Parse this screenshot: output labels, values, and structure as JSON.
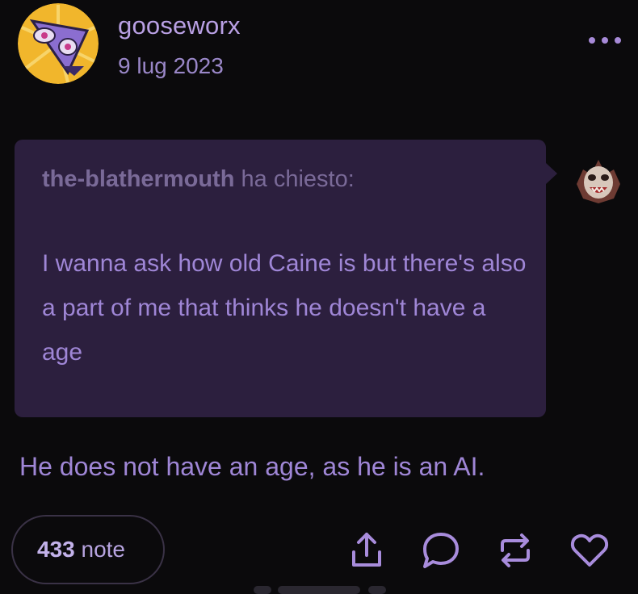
{
  "post": {
    "author": "gooseworx",
    "date": "9 lug 2023",
    "ask": {
      "asker": "the-blathermouth",
      "asked_label": "ha chiesto:",
      "question": "I wanna ask how old Caine is but there's also a part of me that thinks he doesn't have a age"
    },
    "answer": "He does not have an age, as he is an AI.",
    "notes": {
      "count": "433",
      "label": "note"
    }
  },
  "icons": {
    "more": "more-dots-icon",
    "share": "share-icon",
    "reply": "reply-bubble-icon",
    "reblog": "reblog-icon",
    "like": "heart-icon"
  },
  "colors": {
    "background": "#0b0a0c",
    "accent": "#b9a0e4",
    "ask_bubble": "#2c1f3e"
  }
}
